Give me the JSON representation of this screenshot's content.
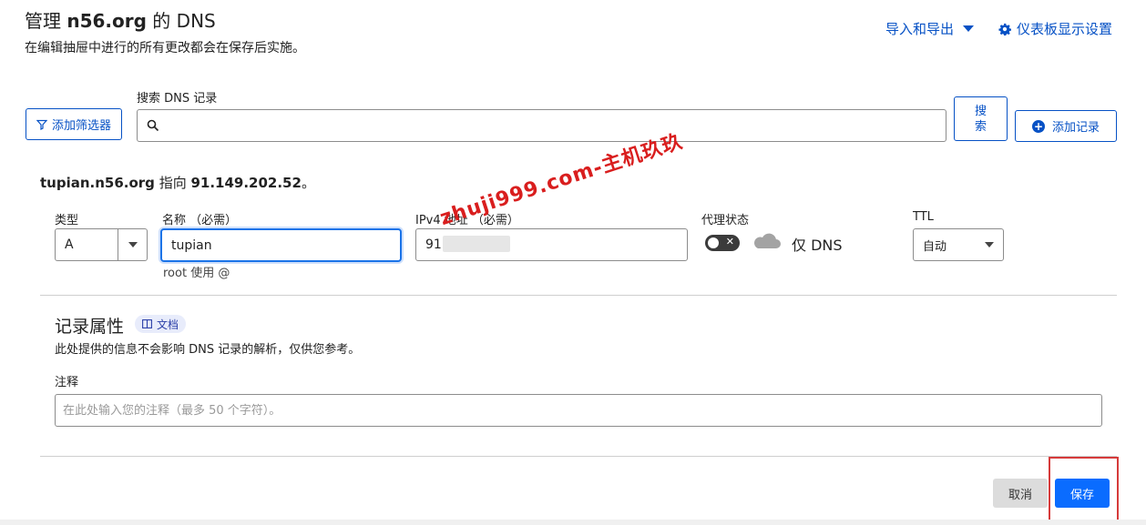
{
  "header": {
    "title_prefix": "管理 ",
    "title_domain": "n56.org",
    "title_suffix": " 的 DNS",
    "subtitle": "在编辑抽屉中进行的所有更改都会在保存后实施。",
    "import_export_label": "导入和导出",
    "dashboard_settings_label": "仪表板显示设置"
  },
  "toolbar": {
    "filter_label": "添加筛选器",
    "search_label": "搜索 DNS 记录",
    "search_value": "",
    "search_button_label": "搜\n索",
    "add_record_label": "添加记录"
  },
  "record": {
    "summary_host": "tupian.n56.org",
    "summary_mid": " 指向 ",
    "summary_ip": "91.149.202.52",
    "summary_end": "。",
    "type_label": "类型",
    "type_value": "A",
    "name_label": "名称 （必需）",
    "name_value": "tupian",
    "name_hint": "root 使用 @",
    "ipv4_label": "IPv4 地址 （必需）",
    "ipv4_value": "91.",
    "proxy_label": "代理状态",
    "proxy_text": "仅 DNS",
    "proxy_on": false,
    "ttl_label": "TTL",
    "ttl_value": "自动"
  },
  "attributes": {
    "title": "记录属性",
    "docs_label": "文档",
    "description": "此处提供的信息不会影响 DNS 记录的解析，仅供您参考。",
    "comment_label": "注释",
    "comment_placeholder": "在此处输入您的注释（最多 50 个字符）。",
    "comment_value": ""
  },
  "footer": {
    "cancel_label": "取消",
    "save_label": "保存"
  },
  "watermark_text": "zhuji999.com-主机玖玖",
  "colors": {
    "accent": "#0651c5",
    "primary_button": "#0a6cff",
    "highlight_box": "#d63b3b",
    "watermark": "#d91e1e"
  }
}
